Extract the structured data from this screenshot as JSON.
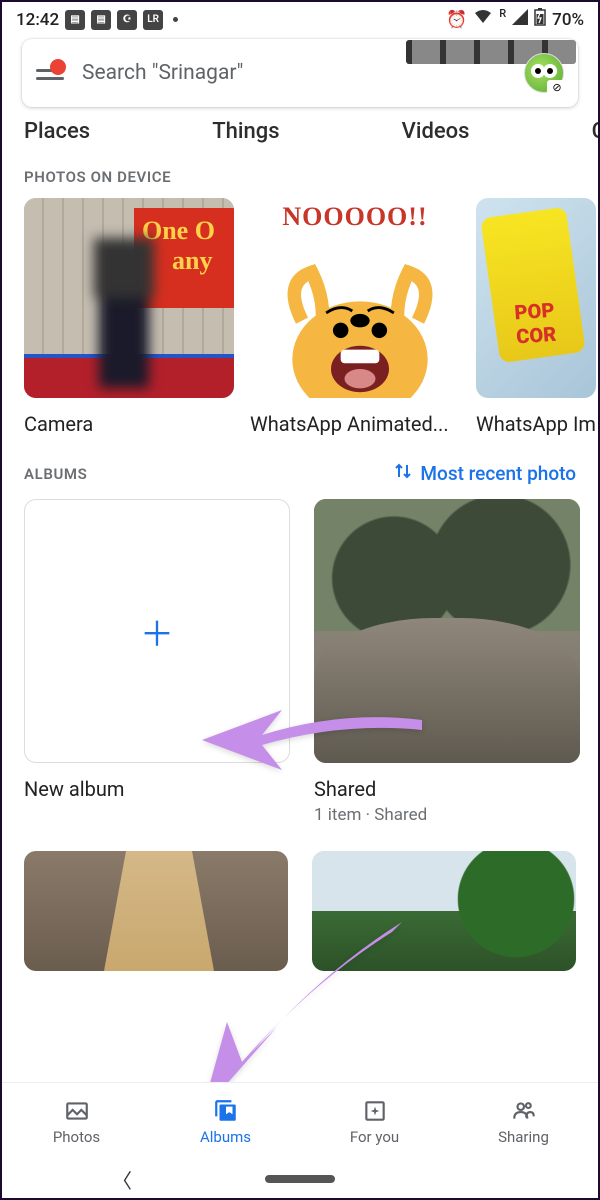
{
  "status": {
    "time": "12:42",
    "icons_left": [
      "msg",
      "msg",
      "pray",
      "LR"
    ],
    "alarm_icon": "alarm-icon",
    "wifi_icon": "wifi-icon",
    "signal_label": "R",
    "battery": "70%"
  },
  "search": {
    "placeholder": "Search \"Srinagar\""
  },
  "categories": {
    "c1": "Places",
    "c2": "Things",
    "c3": "Videos",
    "c4": "C"
  },
  "device": {
    "header": "PHOTOS ON DEVICE",
    "items": [
      {
        "label": "Camera",
        "sign_line1": "One O",
        "sign_line2": "any"
      },
      {
        "label": "WhatsApp Animated...",
        "cry": "NOOOOO!!"
      },
      {
        "label": "WhatsApp Im",
        "bag": "POP COR"
      }
    ]
  },
  "albums": {
    "header": "ALBUMS",
    "sort": "Most recent photo",
    "items": [
      {
        "label": "New album"
      },
      {
        "label": "Shared",
        "sub": "1 item  ·  Shared"
      }
    ]
  },
  "nav": {
    "photos": "Photos",
    "albums": "Albums",
    "foryou": "For you",
    "sharing": "Sharing"
  }
}
